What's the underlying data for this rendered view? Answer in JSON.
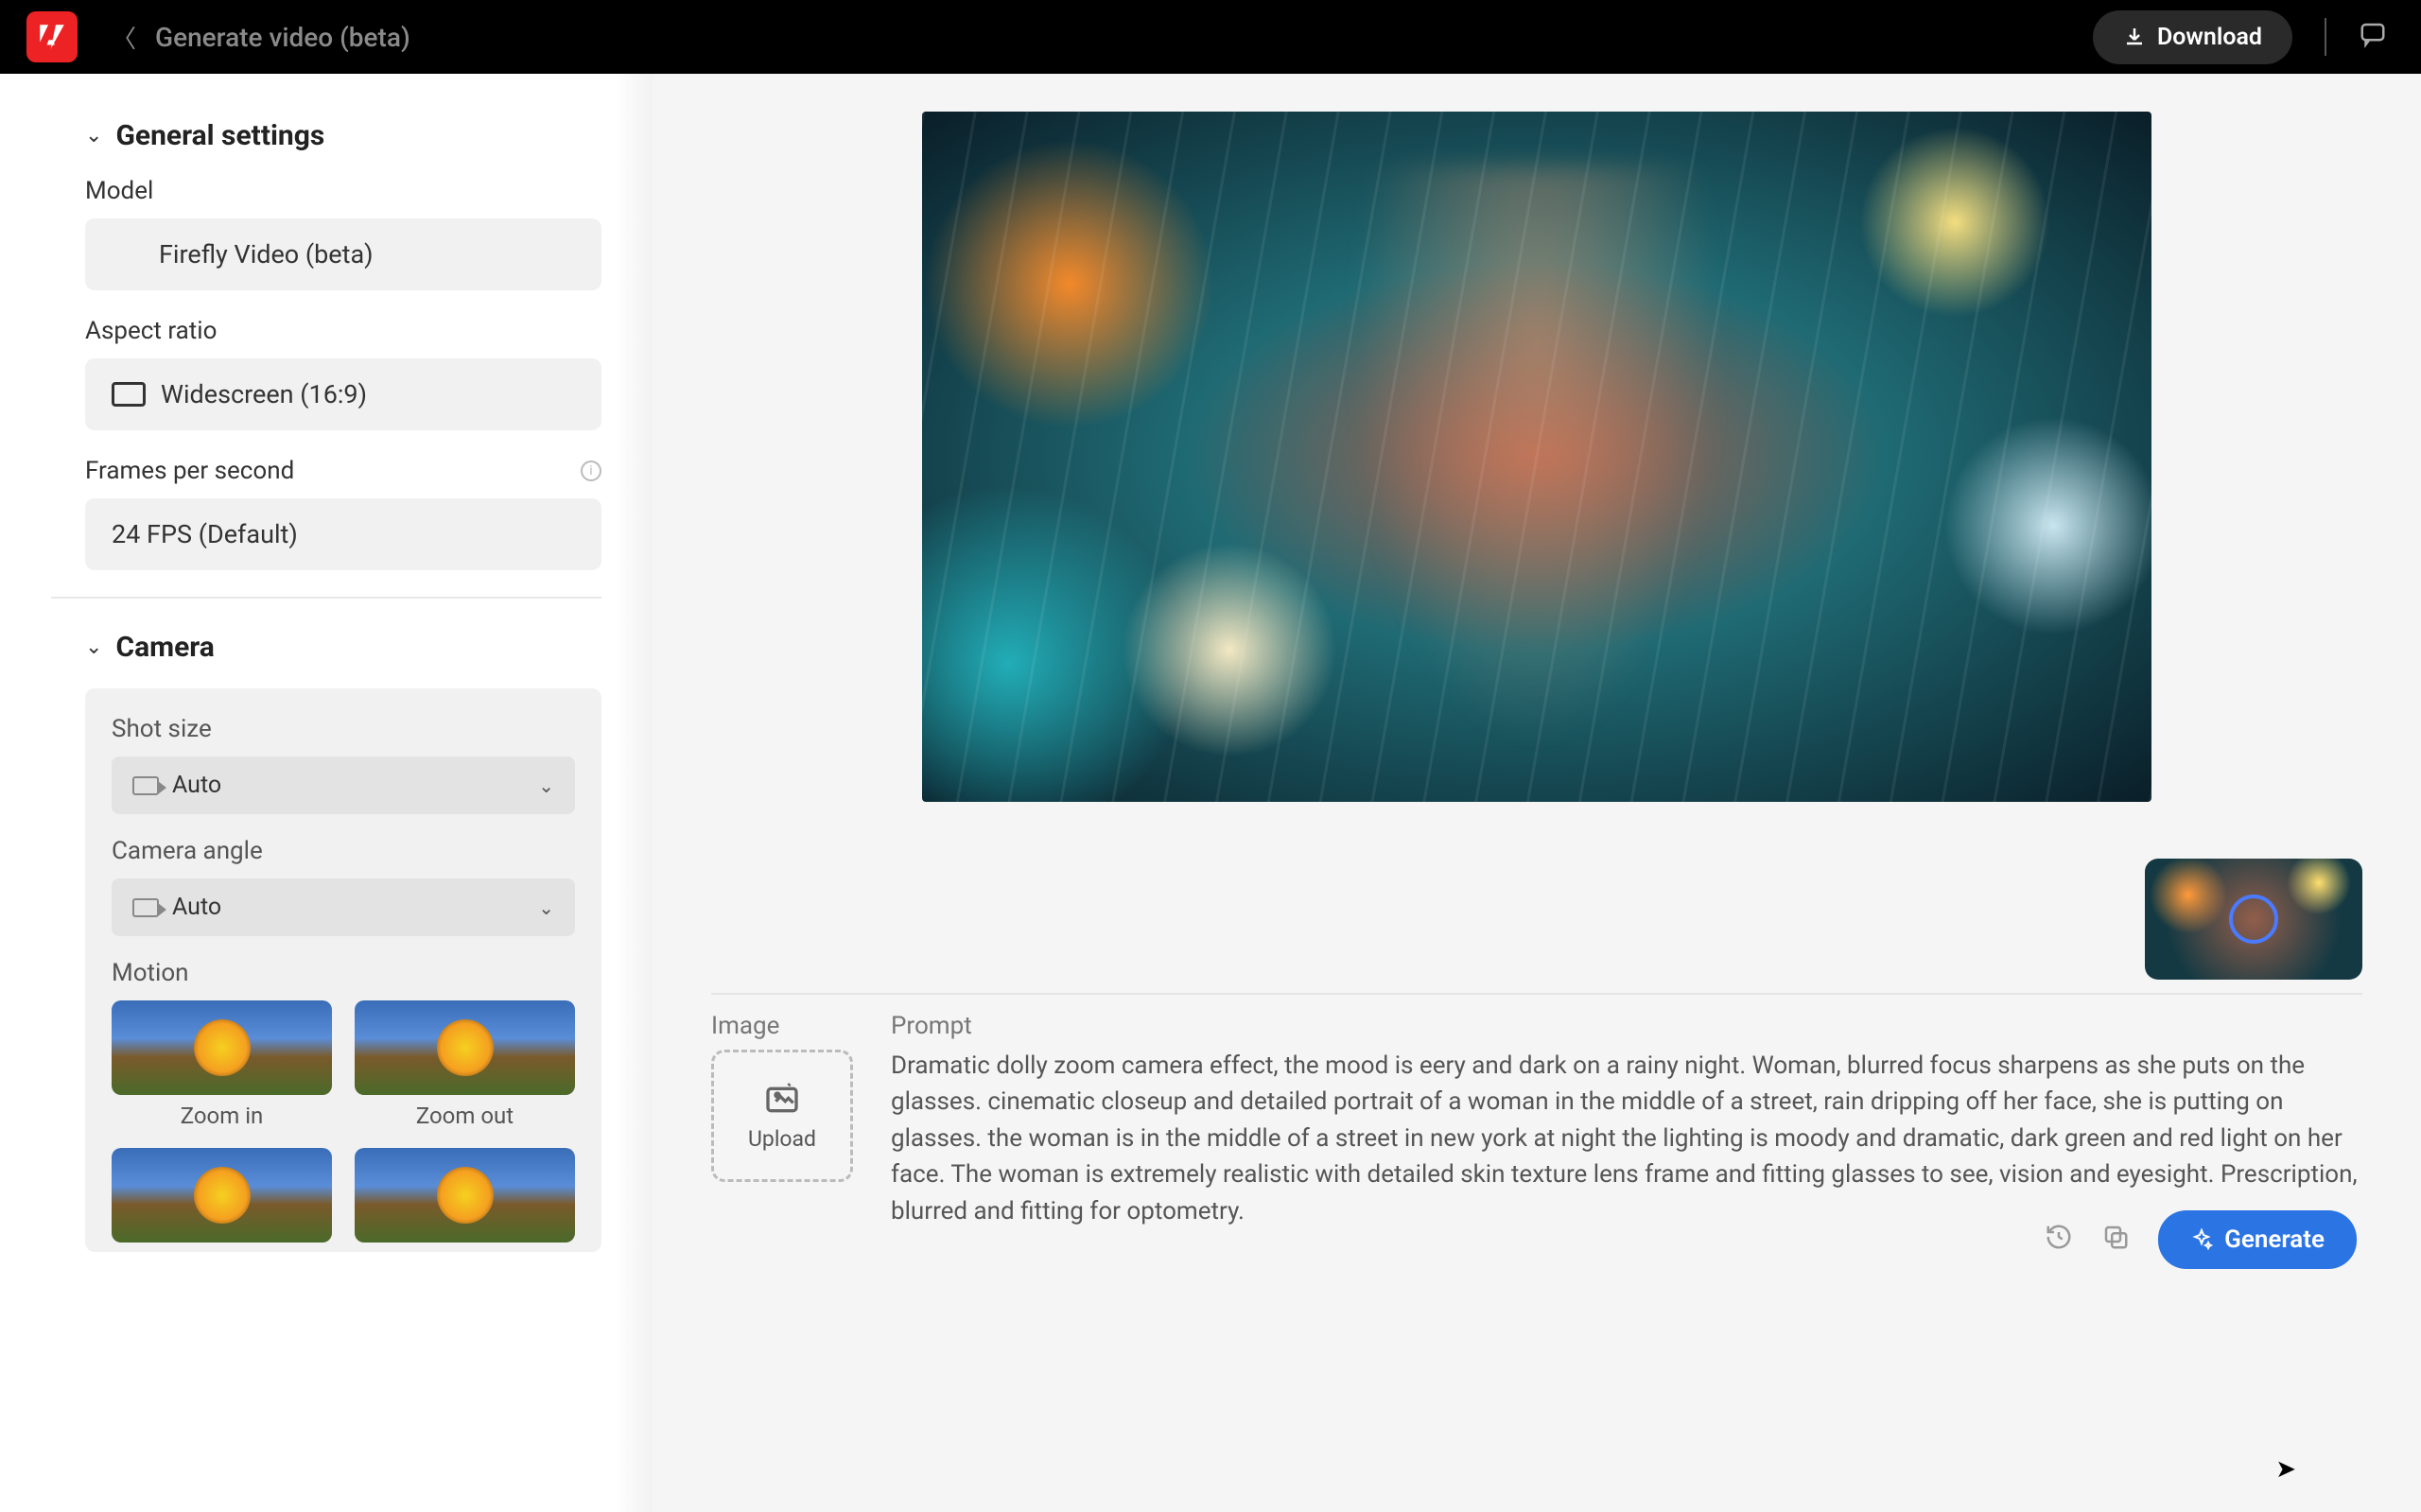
{
  "header": {
    "page_title": "Generate video (beta)",
    "download_label": "Download"
  },
  "sidebar": {
    "general": {
      "title": "General settings",
      "model_label": "Model",
      "model_value": "Firefly Video (beta)",
      "aspect_label": "Aspect ratio",
      "aspect_value": "Widescreen (16:9)",
      "fps_label": "Frames per second",
      "fps_value": "24 FPS (Default)"
    },
    "camera": {
      "title": "Camera",
      "shot_size_label": "Shot size",
      "shot_size_value": "Auto",
      "angle_label": "Camera angle",
      "angle_value": "Auto",
      "motion_label": "Motion",
      "motion_items": [
        "Zoom in",
        "Zoom out"
      ]
    }
  },
  "bottom": {
    "image_label": "Image",
    "upload_label": "Upload",
    "prompt_label": "Prompt",
    "prompt_text": "Dramatic dolly zoom camera effect, the mood is eery and dark on a rainy night. Woman, blurred focus sharpens as she puts on the glasses. cinematic closeup and detailed portrait of a woman in the middle of a street, rain dripping off her face, she is putting on glasses. the woman is in the middle of a street in new york at night the lighting is moody and dramatic, dark green and red light on her face. The woman is extremely realistic with detailed skin texture lens frame and fitting glasses to see, vision and eyesight. Prescription, blurred and fitting for optometry.",
    "generate_label": "Generate"
  }
}
